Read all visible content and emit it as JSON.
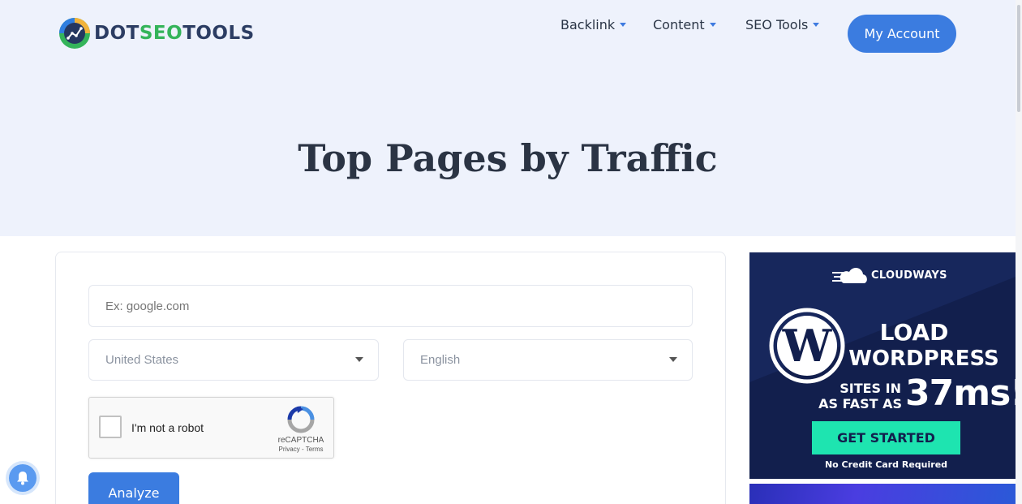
{
  "brand": {
    "logo_part1": "DOT",
    "logo_part2": "SEO",
    "logo_part3": "TOOLS",
    "accent_color": "#3b7ce0",
    "green_color": "#34b45a"
  },
  "nav": {
    "items": [
      {
        "label": "Backlink",
        "icon": "caret-down-icon"
      },
      {
        "label": "Content",
        "icon": "caret-down-icon"
      },
      {
        "label": "SEO Tools",
        "icon": "caret-down-icon"
      }
    ],
    "account_label": "My Account"
  },
  "page": {
    "title": "Top Pages by Traffic"
  },
  "form": {
    "domain_placeholder": "Ex: google.com",
    "domain_value": "",
    "country_selected": "United States",
    "language_selected": "English",
    "captcha_label": "I'm not a robot",
    "captcha_brand": "reCAPTCHA",
    "captcha_links": "Privacy - Terms",
    "analyze_label": "Analyze"
  },
  "ad": {
    "brand": "CLOUDWAYS",
    "headline1": "LOAD",
    "headline2": "WORDPRESS",
    "sub1": "SITES IN",
    "sub2": "AS FAST AS",
    "big": "37ms!",
    "cta": "GET STARTED",
    "note": "No Credit Card Required",
    "bg_color": "#121f4d",
    "cta_color": "#1ee4b0"
  },
  "widgets": {
    "notification_icon": "bell-icon"
  }
}
